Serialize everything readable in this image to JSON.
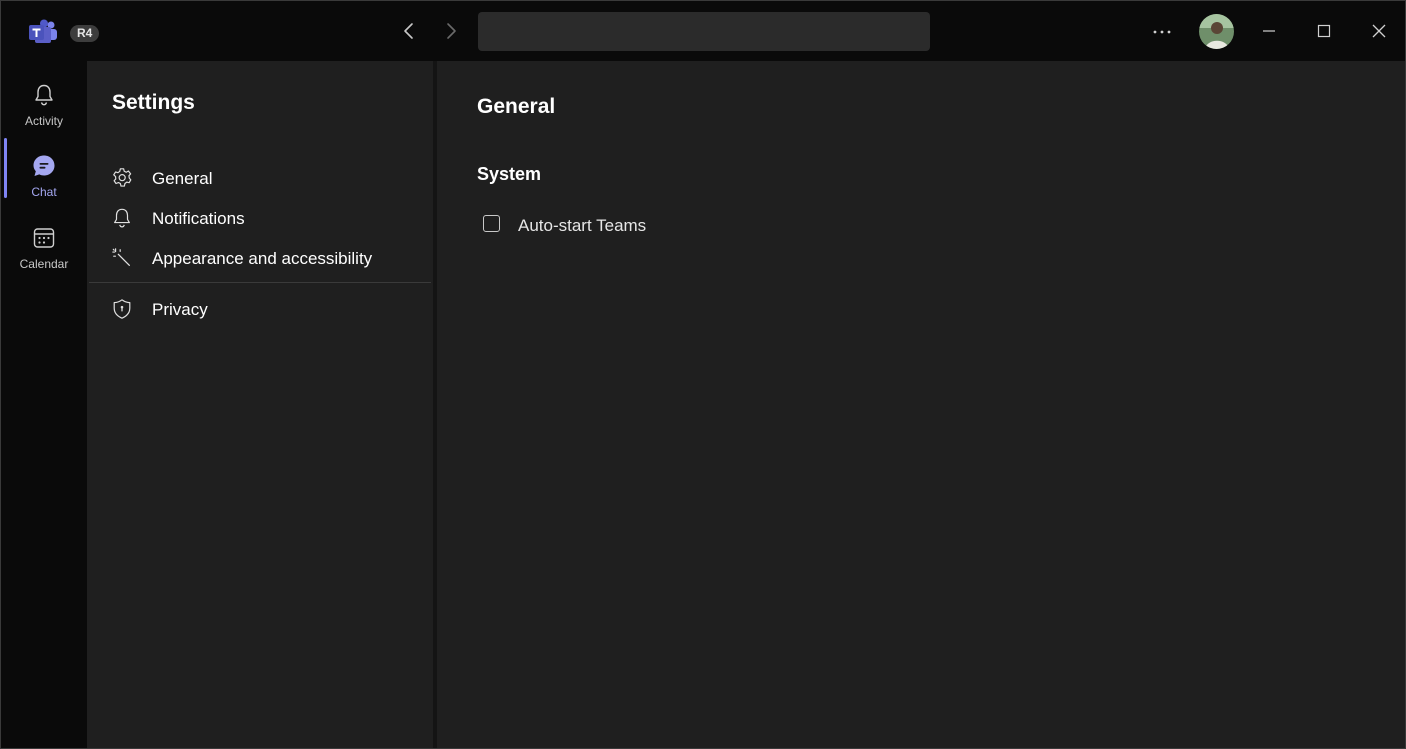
{
  "titlebar": {
    "build_badge": "R4",
    "search": {
      "value": "",
      "placeholder": ""
    }
  },
  "rail": {
    "items": [
      {
        "label": "Activity",
        "icon": "bell-icon"
      },
      {
        "label": "Chat",
        "icon": "chat-icon",
        "active": true
      },
      {
        "label": "Calendar",
        "icon": "calendar-icon"
      }
    ]
  },
  "settings": {
    "title": "Settings",
    "items": [
      {
        "label": "General",
        "icon": "gear-icon",
        "selected": true
      },
      {
        "label": "Notifications",
        "icon": "bell-icon"
      },
      {
        "label": "Appearance and accessibility",
        "icon": "magic-wand-icon"
      },
      {
        "label": "Privacy",
        "icon": "shield-icon"
      }
    ]
  },
  "main": {
    "title": "General",
    "sections": [
      {
        "title": "System",
        "options": [
          {
            "label": "Auto-start Teams",
            "checked": false
          }
        ]
      }
    ]
  },
  "colors": {
    "accent": "#7f85f5",
    "background": "#1f1f1f",
    "titlebar": "#0a0a0a"
  }
}
